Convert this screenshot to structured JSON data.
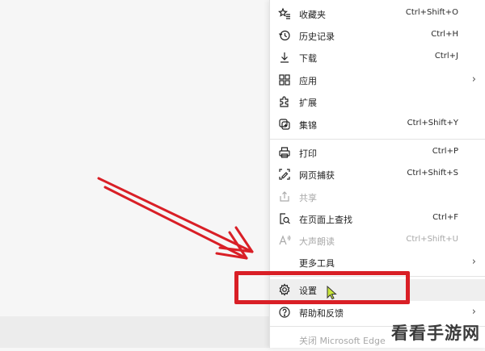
{
  "menu": {
    "items": [
      {
        "label": "收藏夹",
        "shortcut": "Ctrl+Shift+O",
        "icon": "favorites-icon"
      },
      {
        "label": "历史记录",
        "shortcut": "Ctrl+H",
        "icon": "history-icon"
      },
      {
        "label": "下载",
        "shortcut": "Ctrl+J",
        "icon": "download-icon"
      },
      {
        "label": "应用",
        "shortcut": "",
        "icon": "apps-icon",
        "submenu": true
      },
      {
        "label": "扩展",
        "shortcut": "",
        "icon": "extensions-icon"
      },
      {
        "label": "集锦",
        "shortcut": "Ctrl+Shift+Y",
        "icon": "collections-icon"
      },
      {
        "label": "打印",
        "shortcut": "Ctrl+P",
        "icon": "print-icon"
      },
      {
        "label": "网页捕获",
        "shortcut": "Ctrl+Shift+S",
        "icon": "web-capture-icon"
      },
      {
        "label": "共享",
        "shortcut": "",
        "icon": "share-icon",
        "disabled": true
      },
      {
        "label": "在页面上查找",
        "shortcut": "Ctrl+F",
        "icon": "find-icon"
      },
      {
        "label": "大声朗读",
        "shortcut": "Ctrl+Shift+U",
        "icon": "read-aloud-icon",
        "disabled": true
      },
      {
        "label": "更多工具",
        "shortcut": "",
        "icon": "",
        "submenu": true
      },
      {
        "label": "设置",
        "shortcut": "",
        "icon": "settings-icon",
        "highlighted": true
      },
      {
        "label": "帮助和反馈",
        "shortcut": "",
        "icon": "help-icon",
        "submenu": true
      },
      {
        "label": "关闭 Microsoft Edge",
        "shortcut": "",
        "icon": "",
        "disabled": true
      }
    ],
    "chevron": "›"
  },
  "watermark": "看看手游网",
  "colors": {
    "highlight": "#d91f26",
    "cursor": "#c8e63a"
  }
}
